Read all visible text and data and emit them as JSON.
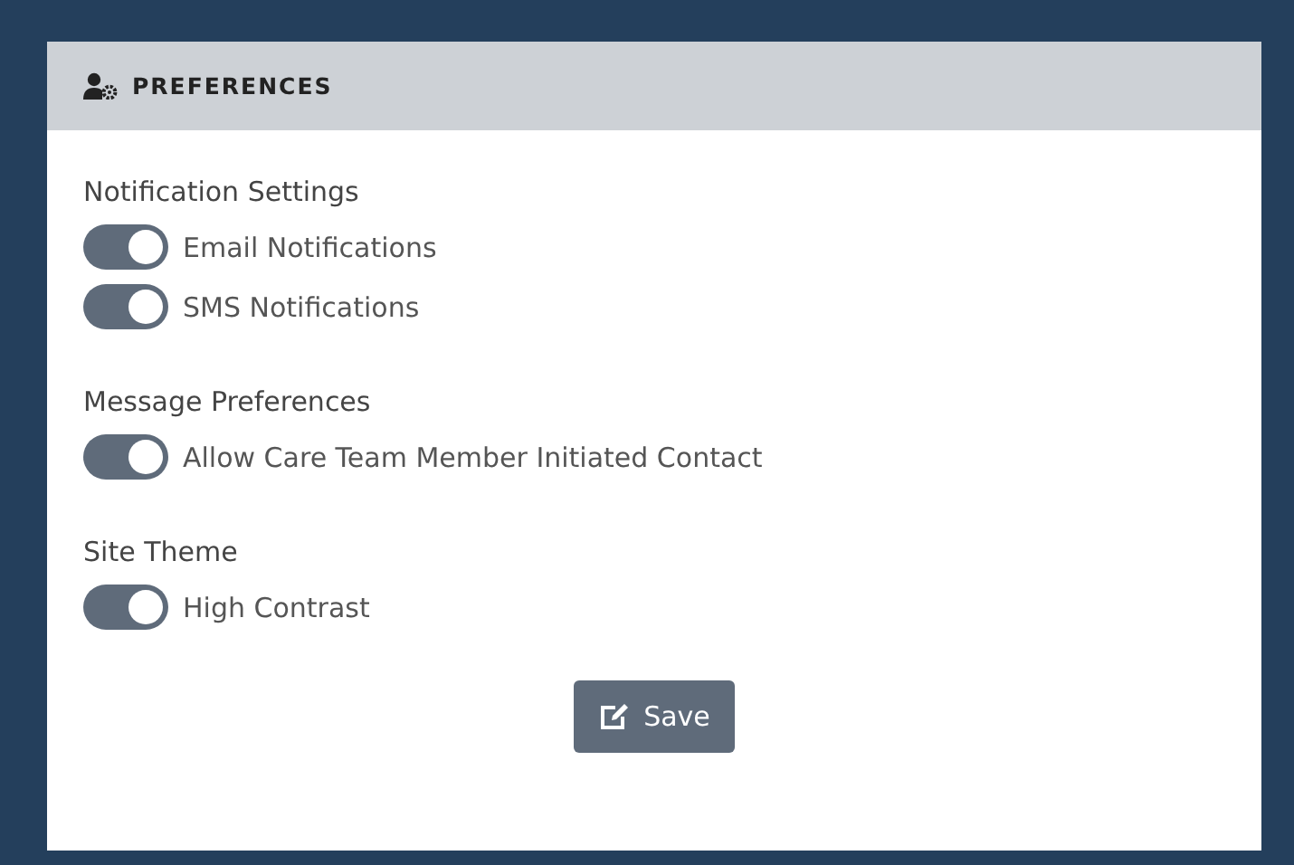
{
  "panel": {
    "title": "PREFERENCES"
  },
  "sections": [
    {
      "title": "Notification Settings",
      "toggles": [
        {
          "label": "Email Notifications",
          "on": true
        },
        {
          "label": "SMS Notifications",
          "on": true
        }
      ]
    },
    {
      "title": "Message Preferences",
      "toggles": [
        {
          "label": "Allow Care Team Member Initiated Contact",
          "on": true
        }
      ]
    },
    {
      "title": "Site Theme",
      "toggles": [
        {
          "label": "High Contrast",
          "on": true
        }
      ]
    }
  ],
  "save_button": {
    "label": "Save"
  }
}
